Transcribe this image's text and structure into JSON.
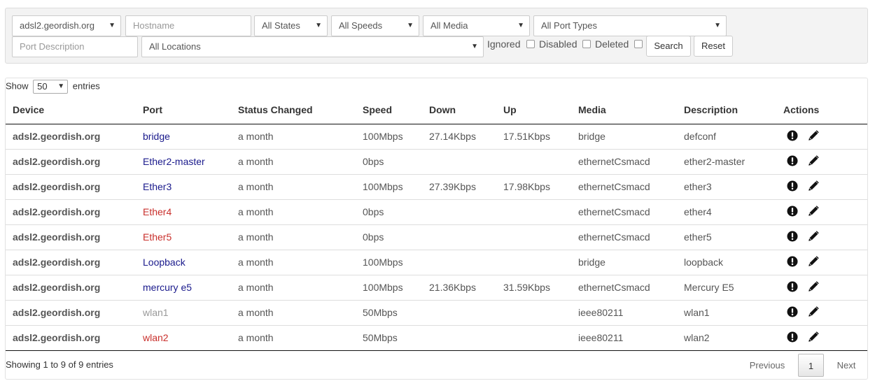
{
  "filters": {
    "device_select": "adsl2.geordish.org",
    "hostname_placeholder": "Hostname",
    "states_select": "All States",
    "speeds_select": "All Speeds",
    "media_select": "All Media",
    "port_types_select": "All Port Types",
    "port_description_placeholder": "Port Description",
    "locations_select": "All Locations",
    "ignored_label": "Ignored",
    "disabled_label": "Disabled",
    "deleted_label": "Deleted",
    "search_button": "Search",
    "reset_button": "Reset"
  },
  "length_menu": {
    "show_label": "Show",
    "value": "50",
    "entries_label": "entries"
  },
  "columns": [
    "Device",
    "Port",
    "Status Changed",
    "Speed",
    "Down",
    "Up",
    "Media",
    "Description",
    "Actions"
  ],
  "rows": [
    {
      "device": "adsl2.geordish.org",
      "port": "bridge",
      "port_status": "up",
      "changed": "a month",
      "speed": "100Mbps",
      "down": "27.14Kbps",
      "up": "17.51Kbps",
      "media": "bridge",
      "description": "defconf"
    },
    {
      "device": "adsl2.geordish.org",
      "port": "Ether2-master",
      "port_status": "up",
      "changed": "a month",
      "speed": "0bps",
      "down": "",
      "up": "",
      "media": "ethernetCsmacd",
      "description": "ether2-master"
    },
    {
      "device": "adsl2.geordish.org",
      "port": "Ether3",
      "port_status": "up",
      "changed": "a month",
      "speed": "100Mbps",
      "down": "27.39Kbps",
      "up": "17.98Kbps",
      "media": "ethernetCsmacd",
      "description": "ether3"
    },
    {
      "device": "adsl2.geordish.org",
      "port": "Ether4",
      "port_status": "down",
      "changed": "a month",
      "speed": "0bps",
      "down": "",
      "up": "",
      "media": "ethernetCsmacd",
      "description": "ether4"
    },
    {
      "device": "adsl2.geordish.org",
      "port": "Ether5",
      "port_status": "down",
      "changed": "a month",
      "speed": "0bps",
      "down": "",
      "up": "",
      "media": "ethernetCsmacd",
      "description": "ether5"
    },
    {
      "device": "adsl2.geordish.org",
      "port": "Loopback",
      "port_status": "up",
      "changed": "a month",
      "speed": "100Mbps",
      "down": "",
      "up": "",
      "media": "bridge",
      "description": "loopback"
    },
    {
      "device": "adsl2.geordish.org",
      "port": "mercury e5",
      "port_status": "up",
      "changed": "a month",
      "speed": "100Mbps",
      "down": "21.36Kbps",
      "up": "31.59Kbps",
      "media": "ethernetCsmacd",
      "description": "Mercury E5"
    },
    {
      "device": "adsl2.geordish.org",
      "port": "wlan1",
      "port_status": "disabled",
      "changed": "a month",
      "speed": "50Mbps",
      "down": "",
      "up": "",
      "media": "ieee80211",
      "description": "wlan1"
    },
    {
      "device": "adsl2.geordish.org",
      "port": "wlan2",
      "port_status": "down",
      "changed": "a month",
      "speed": "50Mbps",
      "down": "",
      "up": "",
      "media": "ieee80211",
      "description": "wlan2"
    }
  ],
  "status_colors": {
    "up": "#1a1a8c",
    "down": "#c9302c",
    "disabled": "#999999"
  },
  "action_icons": [
    "alert-icon",
    "edit-icon"
  ],
  "footer": {
    "info": "Showing 1 to 9 of 9 entries",
    "previous": "Previous",
    "page": "1",
    "next": "Next"
  }
}
